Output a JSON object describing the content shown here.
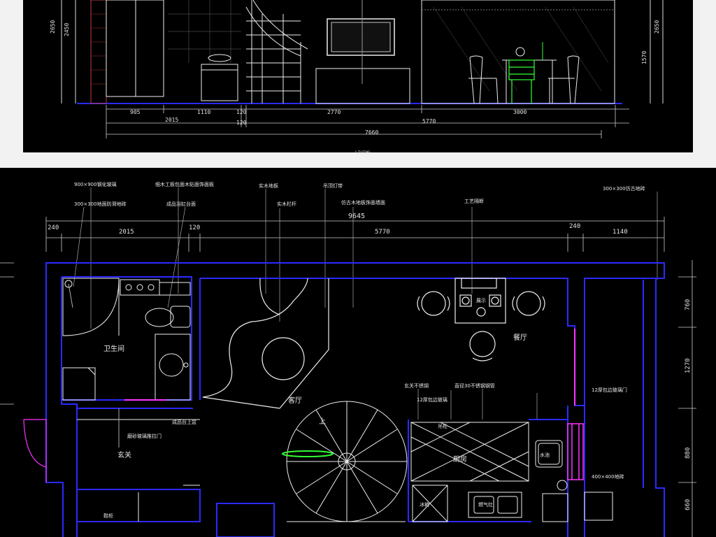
{
  "colors": {
    "background": "#000000",
    "wall": "#2a2aff",
    "lines": "#ffffff",
    "door": "#ff33ff",
    "highlight": "#33ff33"
  },
  "elevation": {
    "dims_left": [
      "2650",
      "2450"
    ],
    "dims_right": [
      "2650",
      "1570"
    ],
    "dims_row1": [
      "905",
      "1110",
      "120",
      "2770",
      "3000"
    ],
    "dims_row2": [
      "2015",
      "120",
      "5770"
    ],
    "dims_total": "7660",
    "caption": "LIVING"
  },
  "plan": {
    "annotations": {
      "a1": "900×900钢化玻璃",
      "a2": "300×300地面防滑地砖",
      "a3": "细木工板包面木贴面饰面板",
      "a4": "成品浴缸台面",
      "a5": "实木地板",
      "a6": "实木栏杆",
      "a7": "吊顶灯带",
      "a8": "仿古木地板饰面墙面",
      "a9": "工艺隔断",
      "a10": "300×300仿古地砖",
      "a11": "成品台上盆",
      "a12": "磨砂玻璃推拉门",
      "a13": "玄关不锈钢",
      "a14": "12厚包边玻璃",
      "a15": "直径30不锈钢钢管",
      "a16": "12厚包边玻璃门",
      "a17": "400×400地砖"
    },
    "dims_top_total": "9645",
    "dims_top": [
      "240",
      "2015",
      "120",
      "5770",
      "240",
      "1140"
    ],
    "dims_right": [
      "760",
      "1270",
      "880",
      "660"
    ],
    "rooms": {
      "bathroom": "卫生间",
      "living": "客厅",
      "dining": "餐厅",
      "kitchen": "厨房",
      "entry": "玄关",
      "up": "上",
      "shoe": "鞋柜",
      "fridge": "冰箱",
      "sink": "水池",
      "stove": "燃气灶",
      "display": "展示",
      "hood": "吊柜"
    }
  }
}
